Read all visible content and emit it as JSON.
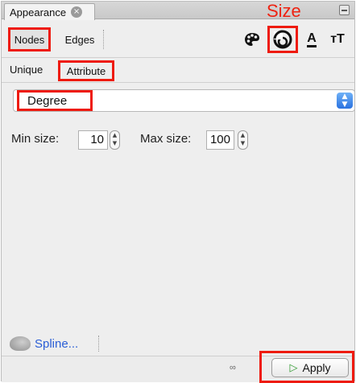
{
  "window": {
    "tab_title": "Appearance",
    "close_glyph": "×",
    "annotation_size": "Size"
  },
  "toolbar": {
    "nodes_label": "Nodes",
    "edges_label": "Edges",
    "icons": {
      "palette": "palette-icon",
      "size": "size-icon",
      "label_color": "A",
      "label_size": "тT"
    }
  },
  "subbar": {
    "unique_label": "Unique",
    "attribute_label": "Attribute"
  },
  "attribute_select": {
    "selected": "Degree"
  },
  "size_settings": {
    "min_label": "Min size:",
    "min_value": "10",
    "max_label": "Max size:",
    "max_value": "100"
  },
  "footer": {
    "spline_label": "Spline...",
    "apply_label": "Apply"
  },
  "colors": {
    "highlight": "#ee1b0f",
    "link": "#2a5ed6",
    "apply_icon": "#2f9a2f"
  }
}
